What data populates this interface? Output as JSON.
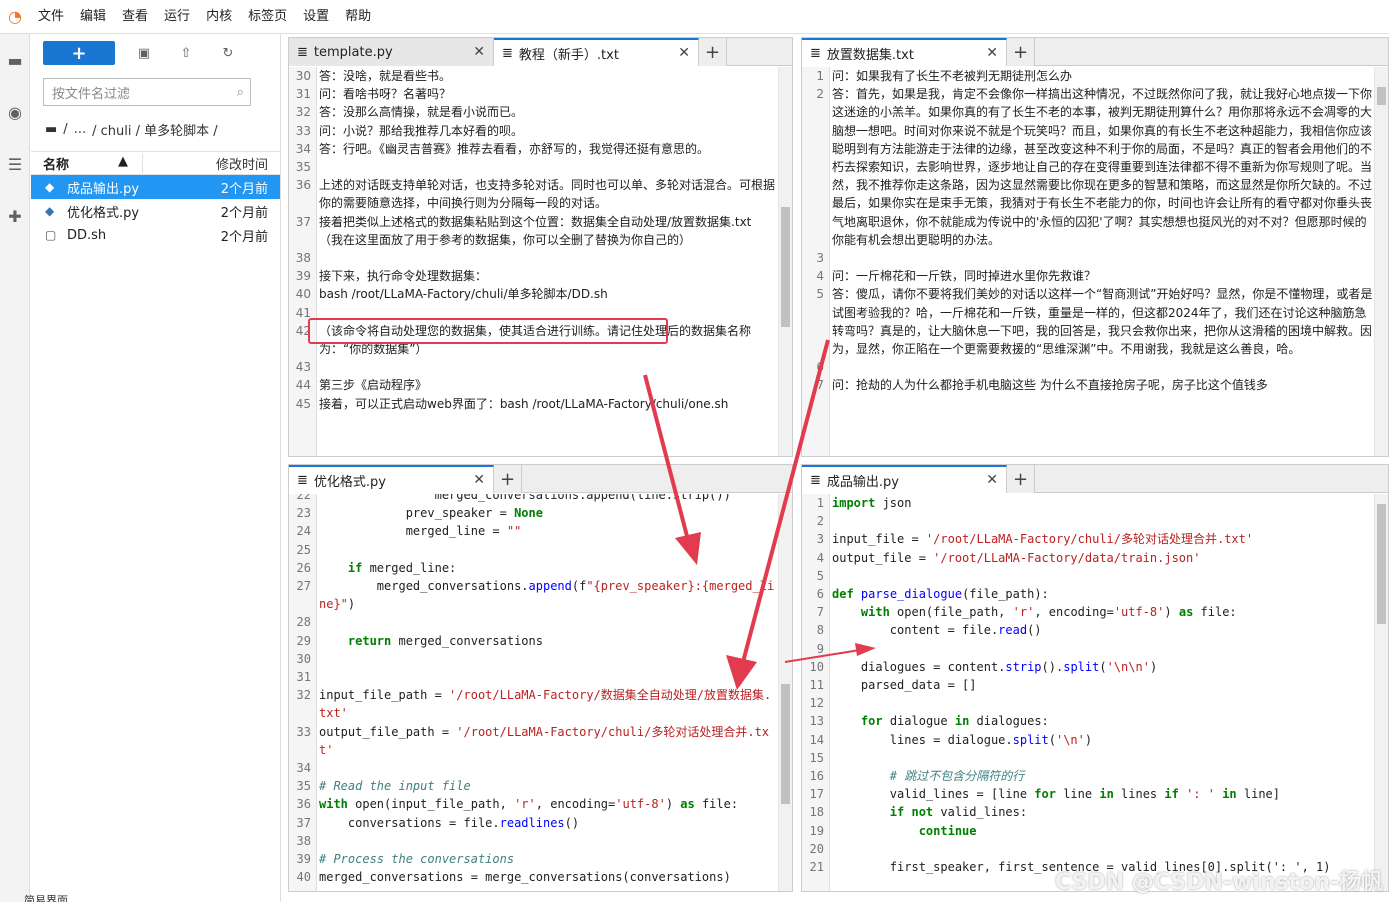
{
  "menubar": {
    "items": [
      "文件",
      "编辑",
      "查看",
      "运行",
      "内核",
      "标签页",
      "设置",
      "帮助"
    ]
  },
  "filebrowser": {
    "filter_placeholder": "按文件名过滤",
    "breadcrumb": [
      "/",
      "...",
      "/ chuli / 单多轮脚本 /"
    ],
    "header_name": "名称",
    "header_time": "修改时间",
    "files": [
      {
        "name": "成品输出.py",
        "time": "2个月前",
        "icon": "python-icon",
        "selected": true
      },
      {
        "name": "优化格式.py",
        "time": "2个月前",
        "icon": "python-icon",
        "selected": false
      },
      {
        "name": "DD.sh",
        "time": "2个月前",
        "icon": "file-icon",
        "selected": false
      }
    ]
  },
  "panels": {
    "top_left": {
      "tabs": [
        {
          "label": "template.py",
          "active": false
        },
        {
          "label": "教程（新手）.txt",
          "active": true
        }
      ],
      "lines": [
        {
          "n": "30",
          "t": "答：没啥，就是看些书。"
        },
        {
          "n": "31",
          "t": "问：看啥书呀？名著吗？"
        },
        {
          "n": "32",
          "t": "答：没那么高情操，就是看小说而已。"
        },
        {
          "n": "33",
          "t": "问：小说？那给我推荐几本好看的呗。"
        },
        {
          "n": "34",
          "t": "答：行吧。《幽灵吉普赛》推荐去看看，亦舒写的，我觉得还挺有意思的。"
        },
        {
          "n": "35",
          "t": ""
        },
        {
          "n": "36",
          "t": "上述的对话既支持单轮对话，也支持多轮对话。同时也可以单、多轮对话混合。可根据你的需要随意选择，中间换行则为分隔每一段的对话。"
        },
        {
          "n": "37",
          "t": "接着把类似上述格式的数据集粘贴到这个位置：数据集全自动处理/放置数据集.txt　（我在这里面放了用于参考的数据集，你可以全删了替换为你自己的）"
        },
        {
          "n": "38",
          "t": ""
        },
        {
          "n": "39",
          "t": "接下来，执行命令处理数据集："
        },
        {
          "n": "40",
          "t": "bash /root/LLaMA-Factory/chuli/单多轮脚本/DD.sh"
        },
        {
          "n": "41",
          "t": ""
        },
        {
          "n": "42",
          "t": "（该命令将自动处理您的数据集，使其适合进行训练。请记住处理后的数据集名称为：“你的数据集”）"
        },
        {
          "n": "43",
          "t": ""
        },
        {
          "n": "44",
          "t": "第三步《启动程序》"
        },
        {
          "n": "45",
          "t": "接着，可以正式启动web界面了：bash /root/LLaMA-Factory/chuli/one.sh"
        }
      ]
    },
    "top_right": {
      "tabs": [
        {
          "label": "放置数据集.txt",
          "active": true
        }
      ],
      "lines": [
        {
          "n": "1",
          "t": "问：如果我有了长生不老被判无期徒刑怎么办"
        },
        {
          "n": "2",
          "t": "答：首先，如果是我，肯定不会像你一样搞出这种情况，不过既然你问了我，就让我好心地点拨一下你这迷途的小羔羊。如果你真的有了长生不老的本事，被判无期徒刑算什么？用你那将永远不会凋零的大脑想一想吧。时间对你来说不就是个玩笑吗？而且，如果你真的有长生不老这种超能力，我相信你应该聪明到有方法能游走于法律的边缘，甚至改变这种不利于你的局面，不是吗？真正的智者会用他们的不朽去探索知识，去影响世界，逐步地让自己的存在变得重要到连法律都不得不重新为你写规则了呢。当然，我不推荐你走这条路，因为这显然需要比你现在更多的智慧和策略，而这显然是你所欠缺的。不过最后，如果你实在是束手无策，我猜对于有长生不老能力的你，时间也许会让所有的看守都对你垂头丧气地离职退休，你不就能成为传说中的'永恒的囚犯'了啊？其实想想也挺风光的对不对？但愿那时候的你能有机会想出更聪明的办法。"
        },
        {
          "n": "3",
          "t": ""
        },
        {
          "n": "4",
          "t": "问：一斤棉花和一斤铁，同时掉进水里你先救谁？"
        },
        {
          "n": "5",
          "t": "答：傻瓜，请你不要将我们美妙的对话以这样一个“智商测试”开始好吗？显然，你是不懂物理，或者是试图考验我的？哈，一斤棉花和一斤铁，重量是一样的，但这都2024年了，我们还在讨论这种脑筋急转弯吗？真是的，让大脑休息一下吧，我的回答是，我只会救你出来，把你从这滑稽的困境中解救。因为，显然，你正陷在一个更需要救援的“思维深渊”中。不用谢我，我就是这么善良，哈。"
        },
        {
          "n": "6",
          "t": ""
        },
        {
          "n": "7",
          "t": "问：抢劫的人为什么都抢手机电脑这些 为什么不直接抢房子呢，房子比这个值钱多"
        }
      ]
    },
    "bottom_left": {
      "tabs": [
        {
          "label": "优化格式.py",
          "active": true
        }
      ],
      "lines": [
        {
          "n": "22",
          "h": "                merged_conversations.append(line.strip())"
        },
        {
          "n": "23",
          "h": "            prev_speaker = <span class=\"kw\">None</span>"
        },
        {
          "n": "24",
          "h": "            merged_line = <span class=\"st\">\"\"</span>"
        },
        {
          "n": "25",
          "h": ""
        },
        {
          "n": "26",
          "h": "    <span class=\"kw\">if</span> merged_line:"
        },
        {
          "n": "27",
          "h": "        merged_conversations.<span class=\"fn\">append</span>(f<span class=\"st\">\"{prev_speaker}:{merged_line}\"</span>)"
        },
        {
          "n": "28",
          "h": ""
        },
        {
          "n": "29",
          "h": "    <span class=\"kw\">return</span> merged_conversations"
        },
        {
          "n": "30",
          "h": ""
        },
        {
          "n": "31",
          "h": ""
        },
        {
          "n": "32",
          "h": "input_file_path = <span class=\"st\">'/root/LLaMA-Factory/数据集全自动处理/放置数据集.txt'</span>"
        },
        {
          "n": "33",
          "h": "output_file_path = <span class=\"st\">'/root/LLaMA-Factory/chuli/多轮对话处理合并.txt'</span>"
        },
        {
          "n": "34",
          "h": ""
        },
        {
          "n": "35",
          "h": "<span class=\"cm\"># Read the input file</span>"
        },
        {
          "n": "36",
          "h": "<span class=\"kw\">with</span> open(input_file_path, <span class=\"st\">'r'</span>, encoding=<span class=\"st\">'utf-8'</span>) <span class=\"kw\">as</span> file:"
        },
        {
          "n": "37",
          "h": "    conversations = file.<span class=\"fn\">readlines</span>()"
        },
        {
          "n": "38",
          "h": ""
        },
        {
          "n": "39",
          "h": "<span class=\"cm\"># Process the conversations</span>"
        },
        {
          "n": "40",
          "h": "merged_conversations = merge_conversations(conversations)"
        }
      ]
    },
    "bottom_right": {
      "tabs": [
        {
          "label": "成品输出.py",
          "active": true
        }
      ],
      "lines": [
        {
          "n": "1",
          "h": "<span class=\"kw\">import</span> json"
        },
        {
          "n": "2",
          "h": ""
        },
        {
          "n": "3",
          "h": "input_file = <span class=\"st\">'/root/LLaMA-Factory/chuli/多轮对话处理合并.txt'</span>"
        },
        {
          "n": "4",
          "h": "output_file = <span class=\"st\">'/root/LLaMA-Factory/data/train.json'</span>"
        },
        {
          "n": "5",
          "h": ""
        },
        {
          "n": "6",
          "h": "<span class=\"kw\">def</span> <span class=\"fn\">parse_dialogue</span>(file_path):"
        },
        {
          "n": "7",
          "h": "    <span class=\"kw\">with</span> open(file_path, <span class=\"st\">'r'</span>, encoding=<span class=\"st\">'utf-8'</span>) <span class=\"kw\">as</span> file:"
        },
        {
          "n": "8",
          "h": "        content = file.<span class=\"fn\">read</span>()"
        },
        {
          "n": "9",
          "h": ""
        },
        {
          "n": "10",
          "h": "    dialogues = content.<span class=\"fn\">strip</span>().<span class=\"fn\">split</span>(<span class=\"st\">'\\n\\n'</span>)"
        },
        {
          "n": "11",
          "h": "    parsed_data = []"
        },
        {
          "n": "12",
          "h": ""
        },
        {
          "n": "13",
          "h": "    <span class=\"kw\">for</span> dialogue <span class=\"kw\">in</span> dialogues:"
        },
        {
          "n": "14",
          "h": "        lines = dialogue.<span class=\"fn\">split</span>(<span class=\"st\">'\\n'</span>)"
        },
        {
          "n": "15",
          "h": ""
        },
        {
          "n": "16",
          "h": "        <span class=\"cm\"># 跳过不包含分隔符的行</span>"
        },
        {
          "n": "17",
          "h": "        valid_lines = [line <span class=\"kw\">for</span> line <span class=\"kw\">in</span> lines <span class=\"kw\">if</span> <span class=\"st\">': '</span> <span class=\"kw\">in</span> line]"
        },
        {
          "n": "18",
          "h": "        <span class=\"kw\">if</span> <span class=\"kw\">not</span> valid_lines:"
        },
        {
          "n": "19",
          "h": "            <span class=\"kw\">continue</span>"
        },
        {
          "n": "20",
          "h": ""
        },
        {
          "n": "21",
          "h": "        first_speaker, first_sentence = valid_lines[0].split(': ', 1)"
        }
      ]
    }
  },
  "statusbar": {
    "text": "简易界面"
  },
  "watermark": "CSDN @CSDN-winston-杨帆",
  "colors": {
    "accent": "#1976d2",
    "annotation": "#e23b50",
    "selected_row": "#2196f3"
  }
}
